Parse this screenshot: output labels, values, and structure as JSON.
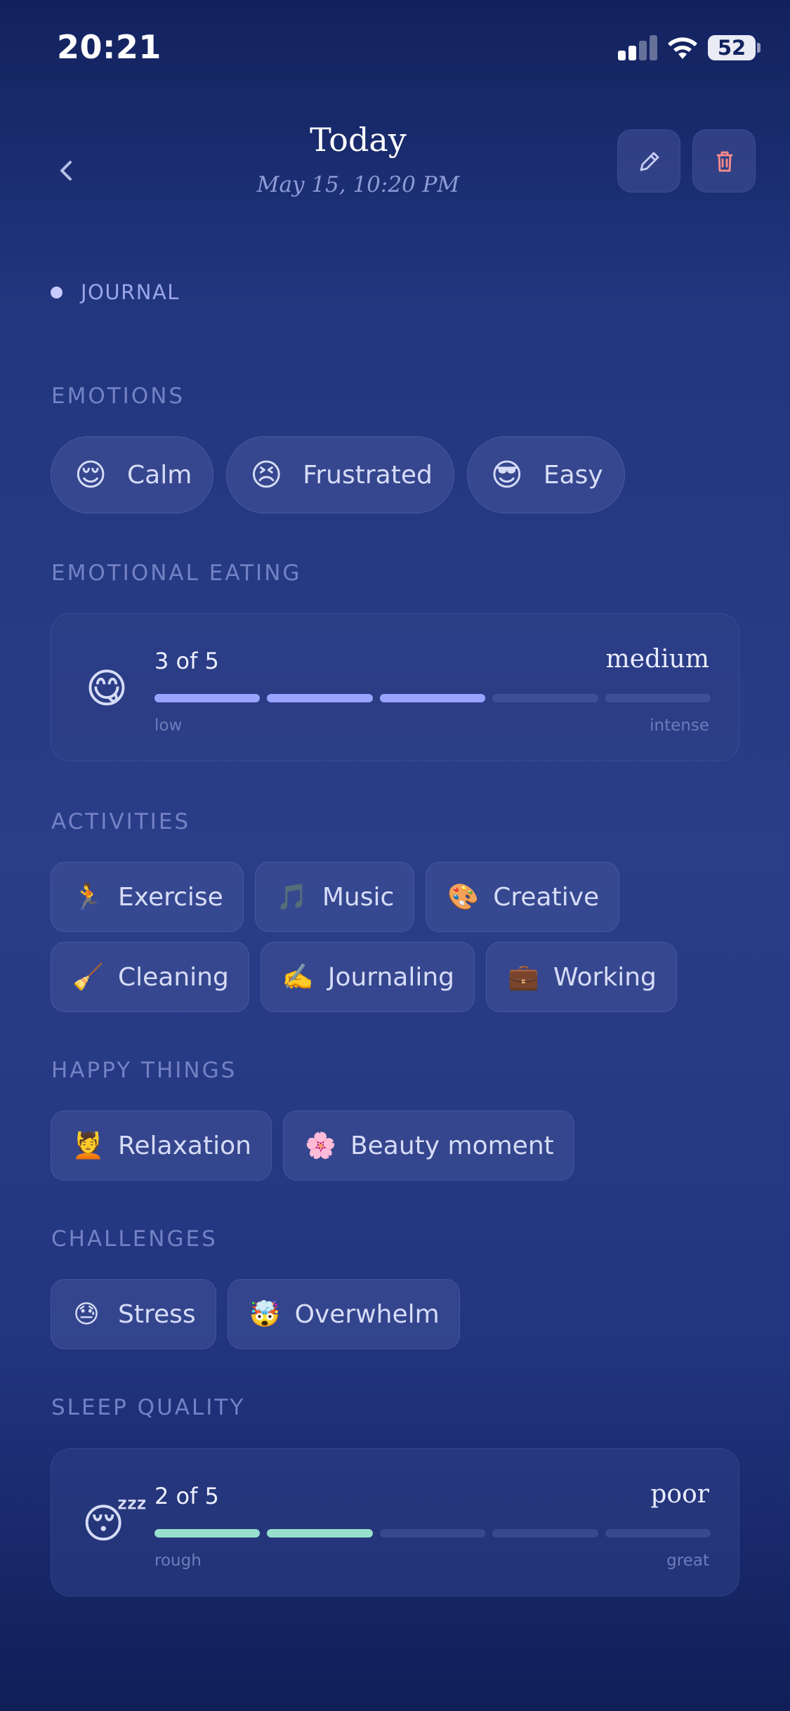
{
  "status_bar": {
    "time": "20:21",
    "battery": "52"
  },
  "header": {
    "back_icon": "chevron-left-icon",
    "title": "Today",
    "subtitle": "May 15, 10:20 PM",
    "edit_icon": "pencil-icon",
    "delete_icon": "trash-icon"
  },
  "journal_tag": "JOURNAL",
  "emotions": {
    "label": "EMOTIONS",
    "items": [
      {
        "emoji": "😌",
        "label": "Calm"
      },
      {
        "emoji": "😣",
        "label": "Frustrated"
      },
      {
        "emoji": "😎",
        "label": "Easy"
      }
    ]
  },
  "emotional_eating": {
    "label": "EMOTIONAL EATING",
    "emoji": "😋",
    "score_text": "3 of 5",
    "level": 3,
    "max": 5,
    "word": "medium",
    "low_label": "low",
    "high_label": "intense",
    "color": "#9aa3ff"
  },
  "activities": {
    "label": "ACTIVITIES",
    "row1": [
      {
        "emoji": "🏃",
        "label": "Exercise"
      },
      {
        "emoji": "🎵",
        "label": "Music"
      },
      {
        "emoji": "🎨",
        "label": "Creative"
      }
    ],
    "row2": [
      {
        "emoji": "🧹",
        "label": "Cleaning"
      },
      {
        "emoji": "✍️",
        "label": "Journaling"
      },
      {
        "emoji": "💼",
        "label": "Working"
      }
    ]
  },
  "happy_things": {
    "label": "HAPPY THINGS",
    "items": [
      {
        "emoji": "💆",
        "label": "Relaxation"
      },
      {
        "emoji": "🌸",
        "label": "Beauty moment"
      }
    ]
  },
  "challenges": {
    "label": "CHALLENGES",
    "items": [
      {
        "emoji": "😓",
        "label": "Stress"
      },
      {
        "emoji": "🤯",
        "label": "Overwhelm"
      }
    ]
  },
  "sleep_quality": {
    "label": "SLEEP QUALITY",
    "emoji": "😴",
    "score_text": "2 of 5",
    "level": 2,
    "max": 5,
    "word": "poor",
    "low_label": "rough",
    "high_label": "great",
    "color": "#97e0cd"
  }
}
